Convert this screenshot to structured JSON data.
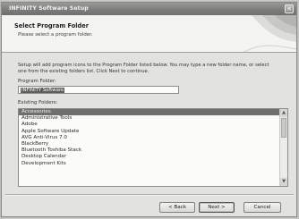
{
  "window": {
    "title": "INFINITY Software Setup",
    "close_glyph": "✕"
  },
  "header": {
    "title": "Select Program Folder",
    "subtitle": "Please select a program folder."
  },
  "content": {
    "description": "Setup will add program icons to the Program Folder listed below. You may type a new folder name, or select one from the existing folders list. Click Next to continue.",
    "program_folder_label": "Program Folder:",
    "program_folder_value": "INFINITY Software",
    "existing_folders_label": "Existing Folders:",
    "existing_folders": [
      "Accessories",
      "Administrative Tools",
      "Adobe",
      "Apple Software Update",
      "AVG Anti-Virus 7.0",
      "BlackBerry",
      "Bluetooth Toshiba Stack",
      "Desktop Calendar",
      "Development Kits"
    ],
    "selected_index": 0
  },
  "buttons": {
    "back": "< Back",
    "next": "Next >",
    "cancel": "Cancel"
  },
  "colors": {
    "titlebar": "#7d7d7c",
    "selection": "#6f6f6d"
  }
}
